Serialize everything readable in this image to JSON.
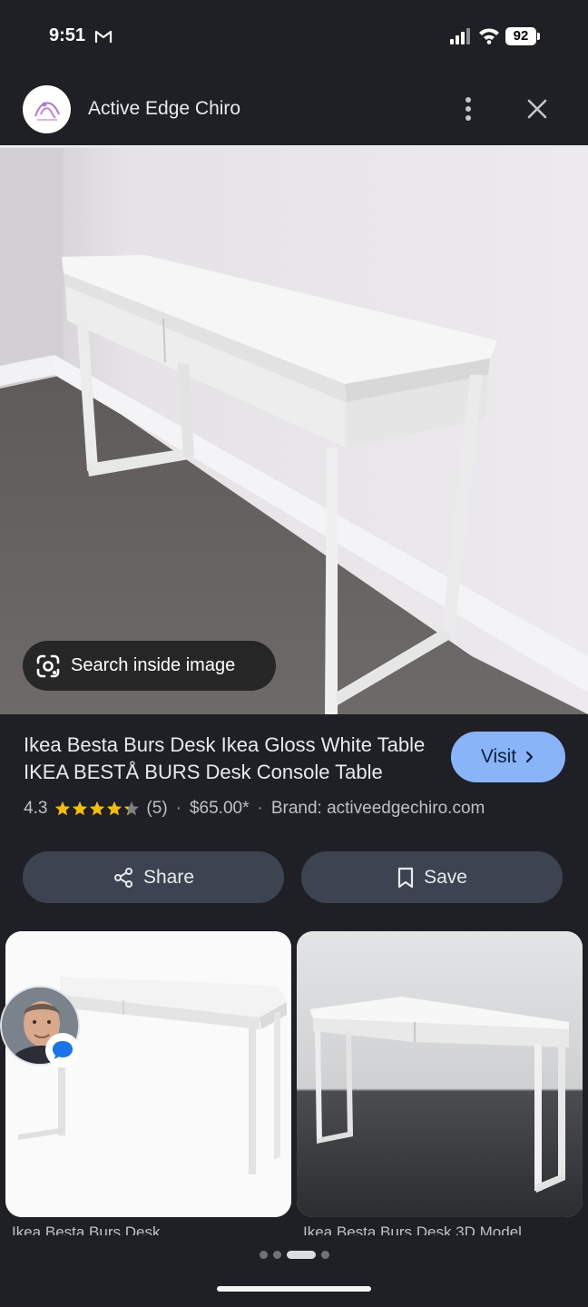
{
  "status_bar": {
    "time": "9:51",
    "battery": "92",
    "mail_icon": "gmail-icon",
    "signal_icon": "signal-bars-icon",
    "wifi_icon": "wifi-icon"
  },
  "header": {
    "site_name": "Active Edge Chiro",
    "more_icon": "more-vert-icon",
    "close_icon": "close-icon"
  },
  "main_image": {
    "description_icon": "desk-photo",
    "lens_chip_label": "Search inside image"
  },
  "product": {
    "title": "Ikea Besta Burs Desk Ikea Gloss White Table IKEA BESTÅ BURS Desk Console Table",
    "rating": "4.3",
    "rating_value": 4.3,
    "rating_max": 5,
    "review_count": "(5)",
    "separator": "·",
    "price": "$65.00*",
    "brand": "Brand: activeedgechiro.com",
    "visit_label": "Visit"
  },
  "actions": {
    "share_label": "Share",
    "save_label": "Save"
  },
  "related": [
    {
      "caption": "Ikea Besta Burs Desk"
    },
    {
      "caption": "Ikea Besta Burs Desk 3D Model"
    }
  ],
  "pager": {
    "count": 4,
    "active_index": 2
  },
  "colors": {
    "background": "#1f2025",
    "accent": "#8ab4f8",
    "button_bg": "#3c4452",
    "star": "#fbbc04"
  }
}
